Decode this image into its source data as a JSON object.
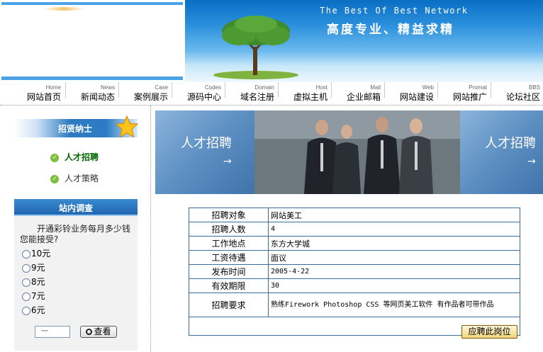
{
  "header": {
    "banner_english": "The Best Of Best Network",
    "banner_chinese": "高度专业、精益求精"
  },
  "nav": [
    {
      "en": "Home",
      "cn": "网站首页"
    },
    {
      "en": "News",
      "cn": "新闻动态"
    },
    {
      "en": "Case",
      "cn": "案例展示"
    },
    {
      "en": "Codes",
      "cn": "源码中心"
    },
    {
      "en": "Domain",
      "cn": "域名注册"
    },
    {
      "en": "Host",
      "cn": "虚拟主机"
    },
    {
      "en": "Mail",
      "cn": "企业邮箱"
    },
    {
      "en": "Web",
      "cn": "网站建设"
    },
    {
      "en": "Promat",
      "cn": "网站推广"
    },
    {
      "en": "BBS",
      "cn": "论坛社区"
    }
  ],
  "sidebar": {
    "panel_title": "招贤纳士",
    "links": [
      {
        "label": "人才招聘"
      },
      {
        "label": "人才策略"
      }
    ],
    "survey": {
      "title": "站内调查",
      "question": "开通彩铃业务每月多少钱您能接受?",
      "options": [
        "10元",
        "9元",
        "8元",
        "7元",
        "6元"
      ],
      "input_value": "一",
      "button_label": "查看"
    }
  },
  "recruit_banner": {
    "left_text": "人才招聘",
    "right_text": "人才招聘",
    "arrow": "→"
  },
  "job": {
    "rows": [
      {
        "label": "招聘对象",
        "value": "网站美工"
      },
      {
        "label": "招聘人数",
        "value": "4"
      },
      {
        "label": "工作地点",
        "value": "东方大学城"
      },
      {
        "label": "工资待遇",
        "value": "面议"
      },
      {
        "label": "发布时间",
        "value": "2005-4-22"
      },
      {
        "label": "有效期限",
        "value": "30"
      },
      {
        "label": "招聘要求",
        "value": "熟练Firework Photoshop CSS 等网页美工软件 有作品者可带作品"
      }
    ],
    "apply_label": "应聘此岗位"
  },
  "colors": {
    "nav_blue": "#2d7cc3",
    "table_border": "#3e6f99",
    "active_link": "#006600"
  }
}
